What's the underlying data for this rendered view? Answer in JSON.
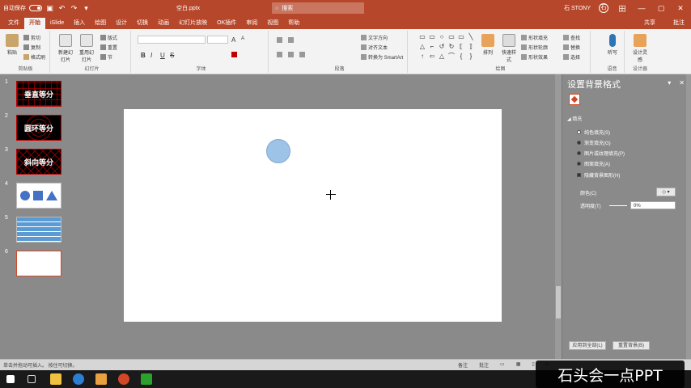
{
  "titlebar": {
    "autosave_label": "自动保存",
    "filename": "空白.pptx",
    "search_placeholder": "搜索",
    "user": "石 STONY",
    "avatar_initial": "石",
    "layout_btn": "田",
    "min": "—",
    "max": "▢",
    "close": "✕",
    "qa_save": "▣",
    "qa_undo": "↶",
    "qa_redo": "↷",
    "qa_more": "▾"
  },
  "tabs": [
    "文件",
    "开始",
    "iSlide",
    "插入",
    "绘图",
    "设计",
    "切换",
    "动画",
    "幻灯片放映",
    "OK插件",
    "审阅",
    "视图",
    "帮助"
  ],
  "tab_share": "共享",
  "tab_comment": "批注",
  "ribbon": {
    "paste": "粘贴",
    "cut": "剪切",
    "copy": "复制",
    "format_painter": "格式刷",
    "clipboard": "剪贴板",
    "new_slide": "新建幻灯片",
    "reuse": "重用幻灯片",
    "layout": "版式",
    "reset": "重置",
    "section": "节",
    "slides": "幻灯片",
    "bold": "B",
    "italic": "I",
    "underline": "U",
    "strike": "S",
    "fontsize_up": "A",
    "fontsize_down": "A",
    "font": "字体",
    "text_direction": "文字方向",
    "align_text": "对齐文本",
    "smartart": "转换为 SmartArt",
    "paragraph": "段落",
    "arrange": "排列",
    "quick_styles": "快速样式",
    "shape_fill": "形状填充",
    "shape_outline": "形状轮廓",
    "shape_effects": "形状效果",
    "drawing": "绘图",
    "find": "查找",
    "replace": "替换",
    "select": "选择",
    "editing": "编辑",
    "dictate": "听写",
    "voice": "语音",
    "ai_design": "设计灵感",
    "designer": "设计器",
    "shape_glyphs": [
      "▭",
      "▭",
      "○",
      "▭",
      "▭",
      "╲",
      "△",
      "⌐",
      "↺",
      "↻",
      "⟦",
      "⟧",
      "↑",
      "⇦",
      "△",
      "⌒",
      "{",
      "}"
    ]
  },
  "slides": [
    {
      "num": "1",
      "label": "垂直等分",
      "style": "dark"
    },
    {
      "num": "2",
      "label": "圆环等分",
      "style": "dark2"
    },
    {
      "num": "3",
      "label": "斜向等分",
      "style": "dark3"
    },
    {
      "num": "4",
      "label": "",
      "style": "white"
    },
    {
      "num": "5",
      "label": "",
      "style": "blue"
    },
    {
      "num": "6",
      "label": "",
      "style": "sel"
    }
  ],
  "panel": {
    "title": "设置背景格式",
    "pin": "▾",
    "close": "✕",
    "fill_section": "◢ 填充",
    "options": [
      "纯色填充(S)",
      "渐变填充(G)",
      "图片或纹理填充(P)",
      "图案填充(A)"
    ],
    "hide_bg": "隐藏背景图形(H)",
    "color_label": "颜色(C)",
    "color_btn": "◇ ▾",
    "transparency_label": "透明度(T)",
    "transparency_value": "0%",
    "reset_btn": "应用到全部(L)",
    "apply_btn": "重置背景(B)"
  },
  "status": {
    "left": "单击并拖动可插入。 按住可切换。",
    "notes": "备注",
    "comments": "批注",
    "view1": "▭",
    "view2": "▦",
    "view3": "▯",
    "view4": "▷"
  },
  "watermark": "石头会一点PPT",
  "colors": {
    "accent": "#b7472a",
    "shape_fill": "#9dc3e6",
    "thumb_blue": "#5b9bd5",
    "thumb_shape": "#4472c4"
  }
}
